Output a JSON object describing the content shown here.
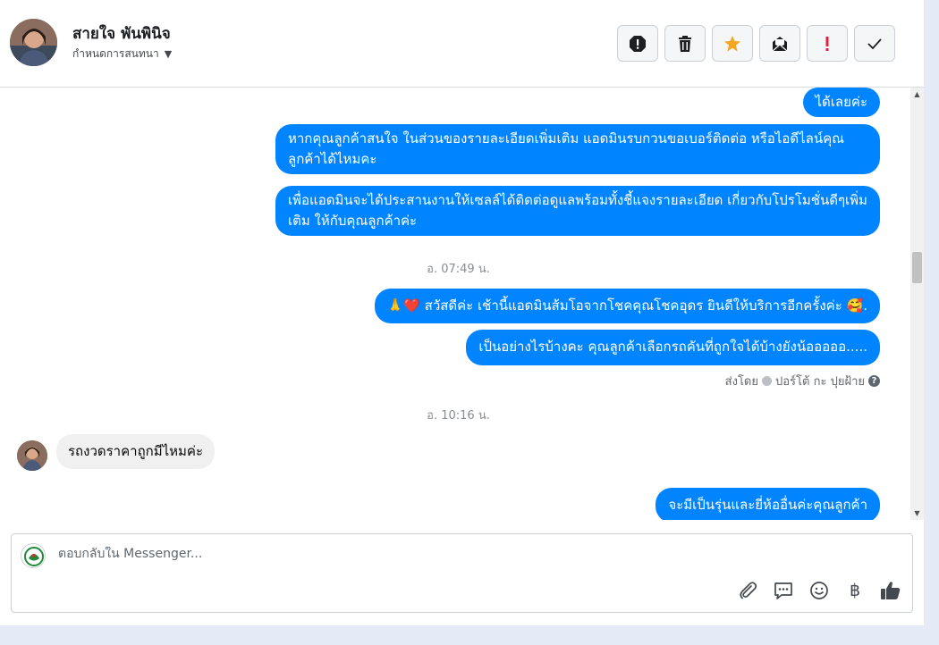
{
  "header": {
    "contact_name": "สายใจ พันพินิจ",
    "assign_label": "กำหนดการสนทนา",
    "actions": [
      {
        "name": "report-button",
        "icon": "alert-octagon-icon"
      },
      {
        "name": "delete-button",
        "icon": "trash-icon"
      },
      {
        "name": "star-button",
        "icon": "star-icon",
        "color": "#f5a623"
      },
      {
        "name": "mark-unread-button",
        "icon": "envelope-open-icon"
      },
      {
        "name": "follow-up-button",
        "icon": "exclamation-icon",
        "color": "#e41e3f"
      },
      {
        "name": "mark-done-button",
        "icon": "checkmark-icon"
      }
    ]
  },
  "thread": {
    "messages_top": [
      {
        "text": "ได้เลยค่ะ"
      },
      {
        "text": "หากคุณลูกค้าสนใจ ในส่วนของรายละเอียดเพิ่มเติม แอดมินรบกวนขอเบอร์ติดต่อ หรือไอดีไลน์คุณลูกค้าได้ไหมคะ"
      },
      {
        "text": "เพื่อแอดมินจะได้ประสานงานให้เซลล์ได้ติดต่อดูแลพร้อมทั้งชี้แจงรายละเอียด เกี่ยวกับโปรโมชั่นดีๆเพิ่มเติม ให้กับคุณลูกค้าค่ะ"
      }
    ],
    "timestamp_1": "อ. 07:49 น.",
    "greeting": {
      "prefix": "🙏❤️",
      "text": "สวัสดีค่ะ เช้านี้แอดมินส้มโอจากโชคคุณโชคอุดร ยินดีให้บริการอีกครั้งค่ะ",
      "suffix": "🥰."
    },
    "followup": "เป็นอย่างไรบ้างคะ คุณลูกค้าเลือกรถคันที่ถูกใจได้บ้างยังน้อออออ.....",
    "sent_by_prefix": "ส่งโดย",
    "sent_by_name": "ปอร์โต้ กะ ปุยฝ้าย",
    "timestamp_2": "อ. 10:16 น.",
    "incoming": "รถงวดราคาถูกมีไหมค่ะ",
    "reply": "จะมีเป็นรุ่นและยี่ห้ออื่นค่ะคุณลูกค้า"
  },
  "composer": {
    "placeholder": "ตอบกลับใน Messenger...",
    "tools": [
      "paperclip-icon",
      "saved-reply-icon",
      "emoji-icon",
      "baht-icon",
      "thumbs-up-icon"
    ],
    "baht_glyph": "฿"
  },
  "colors": {
    "outgoing_bubble": "#0084ff",
    "incoming_bubble": "#f0f0f0",
    "star": "#f5a623",
    "follow_up": "#e41e3f"
  }
}
